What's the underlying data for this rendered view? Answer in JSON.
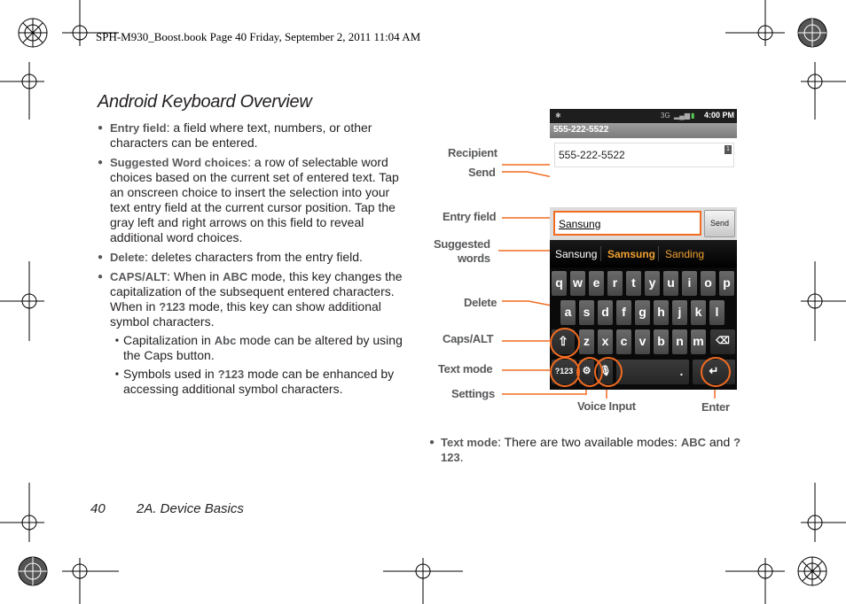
{
  "header": {
    "line": "SPH-M930_Boost.book  Page 40  Friday, September 2, 2011  11:04 AM"
  },
  "title": "Android Keyboard Overview",
  "bullets": [
    {
      "term": "Entry field",
      "text": ": a field where text, numbers, or other characters can be entered."
    },
    {
      "term": "Suggested Word choices",
      "text": ": a row of selectable word choices based on the current set of entered text. Tap an onscreen choice to insert the selection into your text entry field at the current cursor position. Tap the gray left and right arrows on this field to reveal additional word choices."
    },
    {
      "term": "Delete",
      "text": ": deletes characters from the entry field."
    },
    {
      "term": "CAPS/ALT",
      "text_a": ": When in ",
      "abc": "ABC",
      "text_b": " mode, this key changes the capitalization of the subsequent entered characters. When in ",
      "q123": "?123",
      "text_c": " mode, this key can show additional symbol characters."
    }
  ],
  "sub_bullets": [
    {
      "text_a": "Capitalization in ",
      "bold": "Abc",
      "text_b": " mode can be altered by using the Caps button."
    },
    {
      "text_a": "Symbols used in ",
      "bold": "?123",
      "text_b": " mode can be enhanced by accessing additional symbol characters."
    }
  ],
  "text_mode_bullet": {
    "term": "Text mode",
    "text_a": ": There are two available modes: ",
    "abc": "ABC",
    "text_b": " and ",
    "q123": "?123",
    "text_c": "."
  },
  "callouts": {
    "recipient": "Recipient",
    "send": "Send",
    "entry_field": "Entry field",
    "suggested_line1": "Suggested",
    "suggested_line2": "words",
    "delete": "Delete",
    "caps_alt": "Caps/ALT",
    "text_mode": "Text mode",
    "settings": "Settings",
    "voice_input": "Voice Input",
    "enter": "Enter"
  },
  "phone": {
    "status_time": "4:00 PM",
    "status_signal": "3G",
    "number_bar": "555-222-5522",
    "recipient_value": "555-222-5522",
    "recipient_badge": "1",
    "entry_value": "Sansung",
    "send_label": "Send",
    "suggestions": [
      "Sansung",
      "Samsung",
      "Sanding"
    ],
    "row1": [
      "q",
      "w",
      "e",
      "r",
      "t",
      "y",
      "u",
      "i",
      "o",
      "p"
    ],
    "row2": [
      "a",
      "s",
      "d",
      "f",
      "g",
      "h",
      "j",
      "k",
      "l"
    ],
    "row3": [
      "z",
      "x",
      "c",
      "v",
      "b",
      "n",
      "m"
    ],
    "mode_key": "?123",
    "period_key": "."
  },
  "colors": {
    "accent": "#f26b21",
    "term_gray": "#58595b"
  },
  "footer": {
    "page_number": "40",
    "section": "2A. Device Basics"
  }
}
